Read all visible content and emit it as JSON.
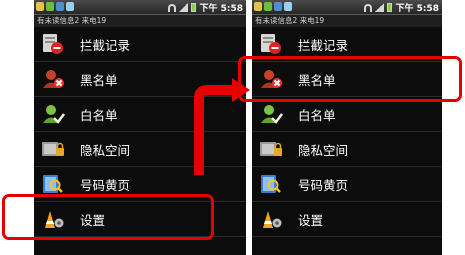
{
  "status_bar": {
    "time": "下午 5:58"
  },
  "notification": {
    "text": "有未读信息2 来电19"
  },
  "menu_items": [
    {
      "label": "拦截记录",
      "icon": "block-log-icon"
    },
    {
      "label": "黑名单",
      "icon": "blacklist-icon"
    },
    {
      "label": "白名单",
      "icon": "whitelist-icon"
    },
    {
      "label": "隐私空间",
      "icon": "privacy-space-icon"
    },
    {
      "label": "号码黄页",
      "icon": "yellow-pages-icon"
    },
    {
      "label": "设置",
      "icon": "settings-icon"
    }
  ],
  "annotations": {
    "left_highlight": "设置",
    "right_highlight": "黑名单",
    "highlight_color": "#e60000"
  }
}
